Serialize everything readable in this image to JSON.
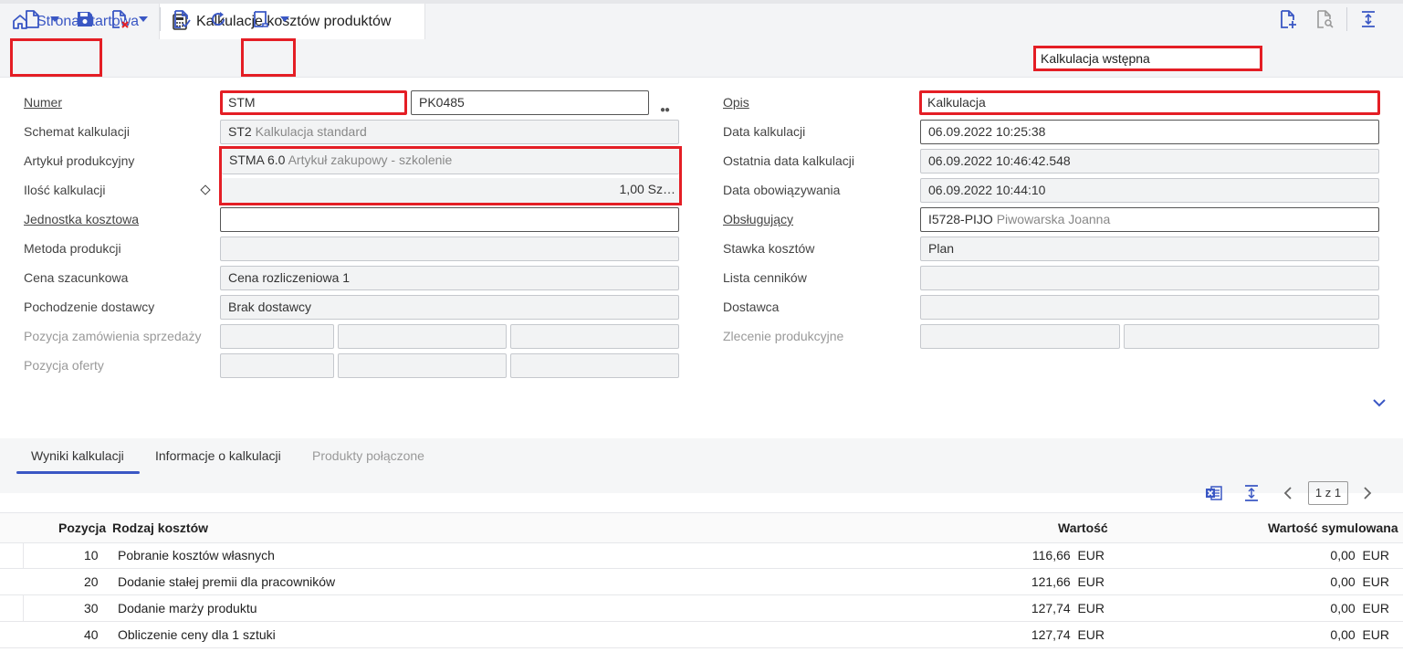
{
  "tabs": {
    "home": "Strona startowa",
    "active": "Kalkulacje kosztów produktów"
  },
  "toolbar": {
    "scenario_value": "Kalkulacja wstępna"
  },
  "form": {
    "left": {
      "numer_label": "Numer",
      "numer_prefix": "STM",
      "numer_value": "PK0485",
      "schemat_label": "Schemat kalkulacji",
      "schemat_code": "ST2",
      "schemat_desc": "Kalkulacja standard",
      "artykul_label": "Artykuł produkcyjny",
      "artykul_code": "STMA 6.0",
      "artykul_desc": "Artykuł zakupowy - szkolenie",
      "ilosc_label": "Ilość kalkulacji",
      "ilosc_value": "1,00 Sz…",
      "jednostka_label": "Jednostka kosztowa",
      "jednostka_value": "",
      "metoda_label": "Metoda produkcji",
      "metoda_value": "",
      "cena_label": "Cena szacunkowa",
      "cena_value": "Cena rozliczeniowa 1",
      "pochodzenie_label": "Pochodzenie dostawcy",
      "pochodzenie_value": "Brak dostawcy",
      "poz_zam_label": "Pozycja zamówienia sprzedaży",
      "poz_oferty_label": "Pozycja oferty"
    },
    "right": {
      "opis_label": "Opis",
      "opis_value": "Kalkulacja",
      "data_kalk_label": "Data kalkulacji",
      "data_kalk_value": "06.09.2022  10:25:38",
      "ostatnia_label": "Ostatnia data kalkulacji",
      "ostatnia_value": "06.09.2022  10:46:42.548",
      "obowiaz_label": "Data obowiązywania",
      "obowiaz_value": "06.09.2022  10:44:10",
      "obslugujacy_label": "Obsługujący",
      "obslugujacy_code": "I5728-PIJO",
      "obslugujacy_name": "Piwowarska Joanna",
      "stawka_label": "Stawka kosztów",
      "stawka_value": "Plan",
      "lista_label": "Lista cenników",
      "lista_value": "",
      "dostawca_label": "Dostawca",
      "dostawca_value": "",
      "zlecenie_label": "Zlecenie produkcyjne"
    }
  },
  "lower_tabs": [
    "Wyniki kalkulacji",
    "Informacje o kalkulacji",
    "Produkty połączone"
  ],
  "pager": "1 z 1",
  "grid": {
    "headers": [
      "Pozycja",
      "Rodzaj kosztów",
      "Wartość",
      "Wartość symulowana"
    ],
    "rows": [
      {
        "pos": "10",
        "type": "Pobranie kosztów własnych",
        "value": "116,66",
        "cur": "EUR",
        "sim": "0,00",
        "sim_cur": "EUR"
      },
      {
        "pos": "20",
        "type": "Dodanie stałej premii dla pracowników",
        "value": "121,66",
        "cur": "EUR",
        "sim": "0,00",
        "sim_cur": "EUR"
      },
      {
        "pos": "30",
        "type": "Dodanie marży produktu",
        "value": "127,74",
        "cur": "EUR",
        "sim": "0,00",
        "sim_cur": "EUR"
      },
      {
        "pos": "40",
        "type": "Obliczenie ceny dla 1 sztuki",
        "value": "127,74",
        "cur": "EUR",
        "sim": "0,00",
        "sim_cur": "EUR"
      }
    ]
  },
  "colors": {
    "accent": "#3a57c4",
    "highlight": "#e41e25"
  }
}
